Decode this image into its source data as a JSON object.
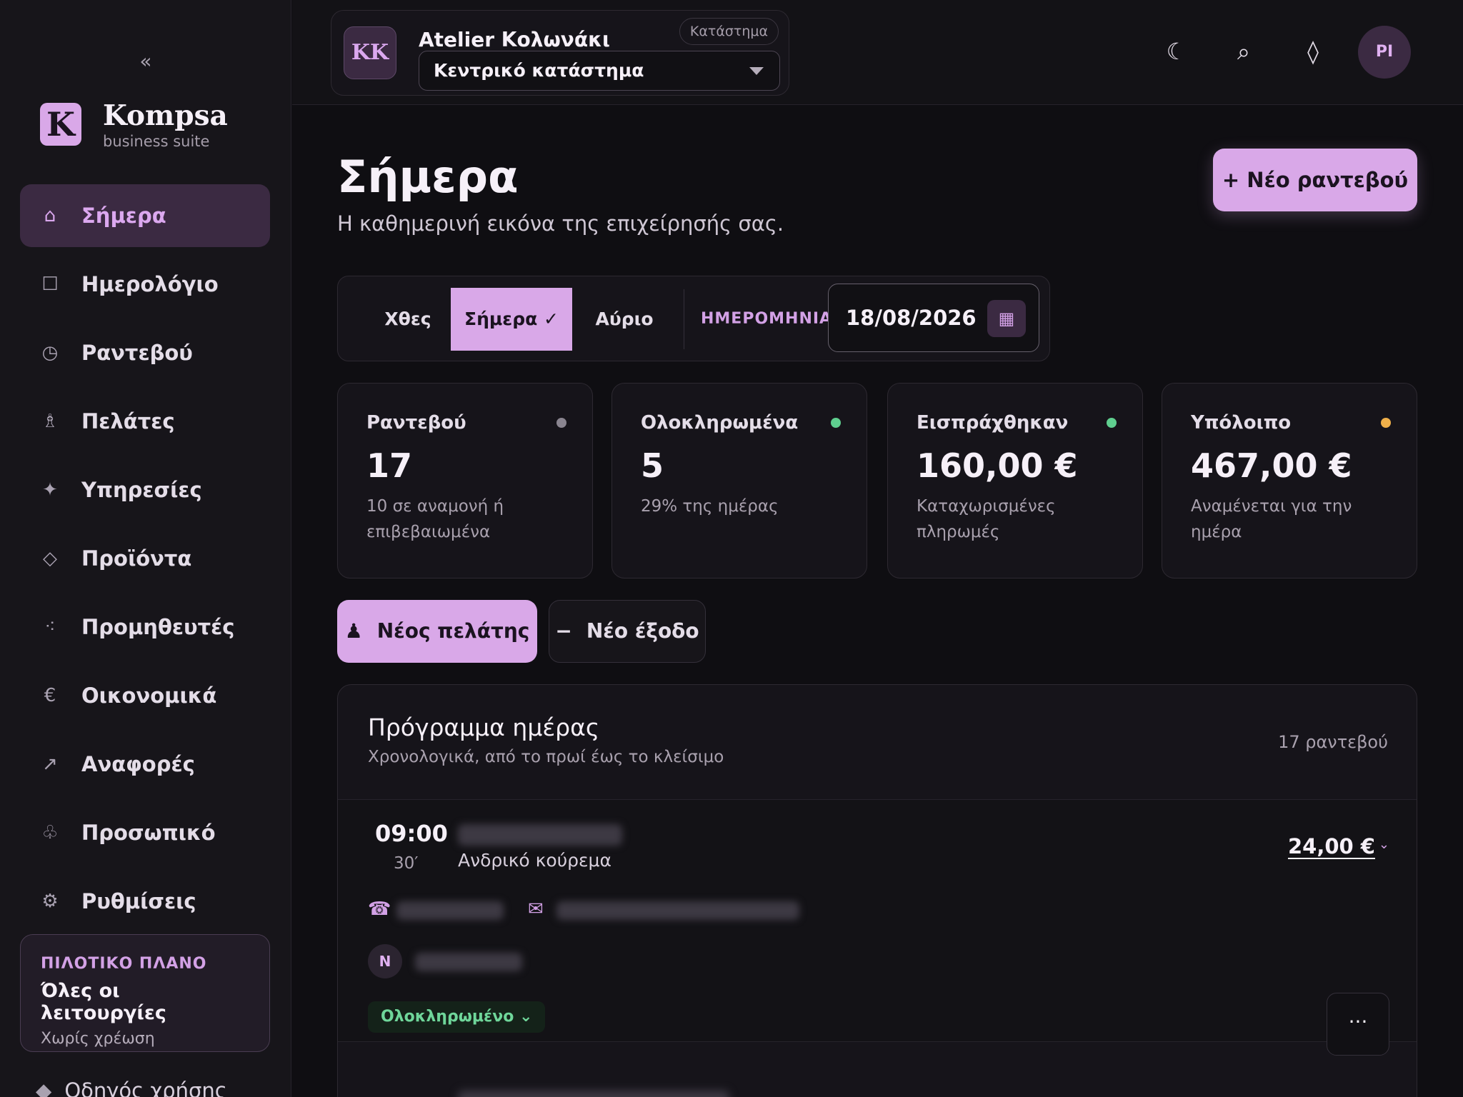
{
  "sidebar": {
    "collapse_glyph": "«",
    "brand": {
      "logo_letter": "K",
      "name": "Kompsa",
      "subtitle": "business suite"
    },
    "items": [
      {
        "label": "Σήμερα",
        "icon": "home-icon",
        "glyph": "⌂",
        "active": true
      },
      {
        "label": "Ημερολόγιο",
        "icon": "calendar-icon",
        "glyph": "☐",
        "active": false
      },
      {
        "label": "Ραντεβού",
        "icon": "clock-icon",
        "glyph": "◷",
        "active": false
      },
      {
        "label": "Πελάτες",
        "icon": "person-icon",
        "glyph": "♗",
        "active": false
      },
      {
        "label": "Υπηρεσίες",
        "icon": "sparkle-icon",
        "glyph": "✦",
        "active": false
      },
      {
        "label": "Προϊόντα",
        "icon": "diamond-icon",
        "glyph": "◇",
        "active": false
      },
      {
        "label": "Προμηθευτές",
        "icon": "network-icon",
        "glyph": "⁖",
        "active": false
      },
      {
        "label": "Οικονομικά",
        "icon": "euro-icon",
        "glyph": "€",
        "active": false
      },
      {
        "label": "Αναφορές",
        "icon": "arrow-up-right-icon",
        "glyph": "↗",
        "active": false
      },
      {
        "label": "Προσωπικό",
        "icon": "club-icon",
        "glyph": "♧",
        "active": false
      },
      {
        "label": "Ρυθμίσεις",
        "icon": "gear-icon",
        "glyph": "⚙",
        "active": false
      }
    ],
    "plan": {
      "tag": "ΠΙΛΟΤΙΚΟ ΠΛΑΝΟ",
      "title": "Όλες οι λειτουργίες",
      "subtitle": "Χωρίς χρέωση"
    },
    "guide": {
      "glyph": "◆",
      "label": "Οδηγός χρήσης"
    }
  },
  "topbar": {
    "store": {
      "initials": "KK",
      "name": "Atelier Κολωνάκι",
      "chip": "Κατάστημα",
      "selected": "Κεντρικό κατάστημα"
    },
    "icons": {
      "theme": "☾",
      "search": "⌕",
      "notifications": "◊"
    },
    "user_initials": "PI"
  },
  "page": {
    "title": "Σήμερα",
    "subtitle": "Η καθημερινή εικόνα της επιχείρησής σας.",
    "new_appointment": "+ Νέο ραντεβού"
  },
  "date_bar": {
    "yesterday": "Χθες",
    "today": "Σήμερα ✓",
    "tomorrow": "Αύριο",
    "date_label": "ΗΜΕΡΟΜΗΝΙΑ",
    "date_value": "18/08/2026",
    "calendar_glyph": "▦"
  },
  "stats": [
    {
      "label": "Ραντεβού",
      "value": "17",
      "note": "10 σε αναμονή ή επιβεβαιωμένα",
      "dot": "#8a8590"
    },
    {
      "label": "Ολοκληρωμένα",
      "value": "5",
      "note": "29% της ημέρας",
      "dot": "#5fcf8f"
    },
    {
      "label": "Εισπράχθηκαν",
      "value": "160,00 €",
      "note": "Καταχωρισμένες πληρωμές",
      "dot": "#5fcf8f"
    },
    {
      "label": "Υπόλοιπο",
      "value": "467,00 €",
      "note": "Αναμένεται για την ημέρα",
      "dot": "#f0b04a"
    }
  ],
  "actions": {
    "new_client": {
      "glyph": "♟",
      "label": "Νέος πελάτης"
    },
    "new_expense": {
      "glyph": "−",
      "label": "Νέο έξοδο"
    }
  },
  "schedule": {
    "title": "Πρόγραμμα ημέρας",
    "subtitle": "Χρονολογικά, από το πρωί έως το κλείσιμο",
    "count": "17 ραντεβού",
    "rows": [
      {
        "time": "09:00",
        "duration": "30′",
        "service": "Ανδρικό κούρεμα",
        "price": "24,00 €",
        "phone_glyph": "☎",
        "mail_glyph": "✉",
        "staff_initial": "N",
        "status": "Ολοκληρωμένο ⌄",
        "more": "···"
      }
    ]
  },
  "colors": {
    "accent": "#d9a8e8",
    "background": "#0f0e12",
    "sidebar": "#17151a",
    "success": "#5fcf8f",
    "warning": "#f0b04a"
  }
}
